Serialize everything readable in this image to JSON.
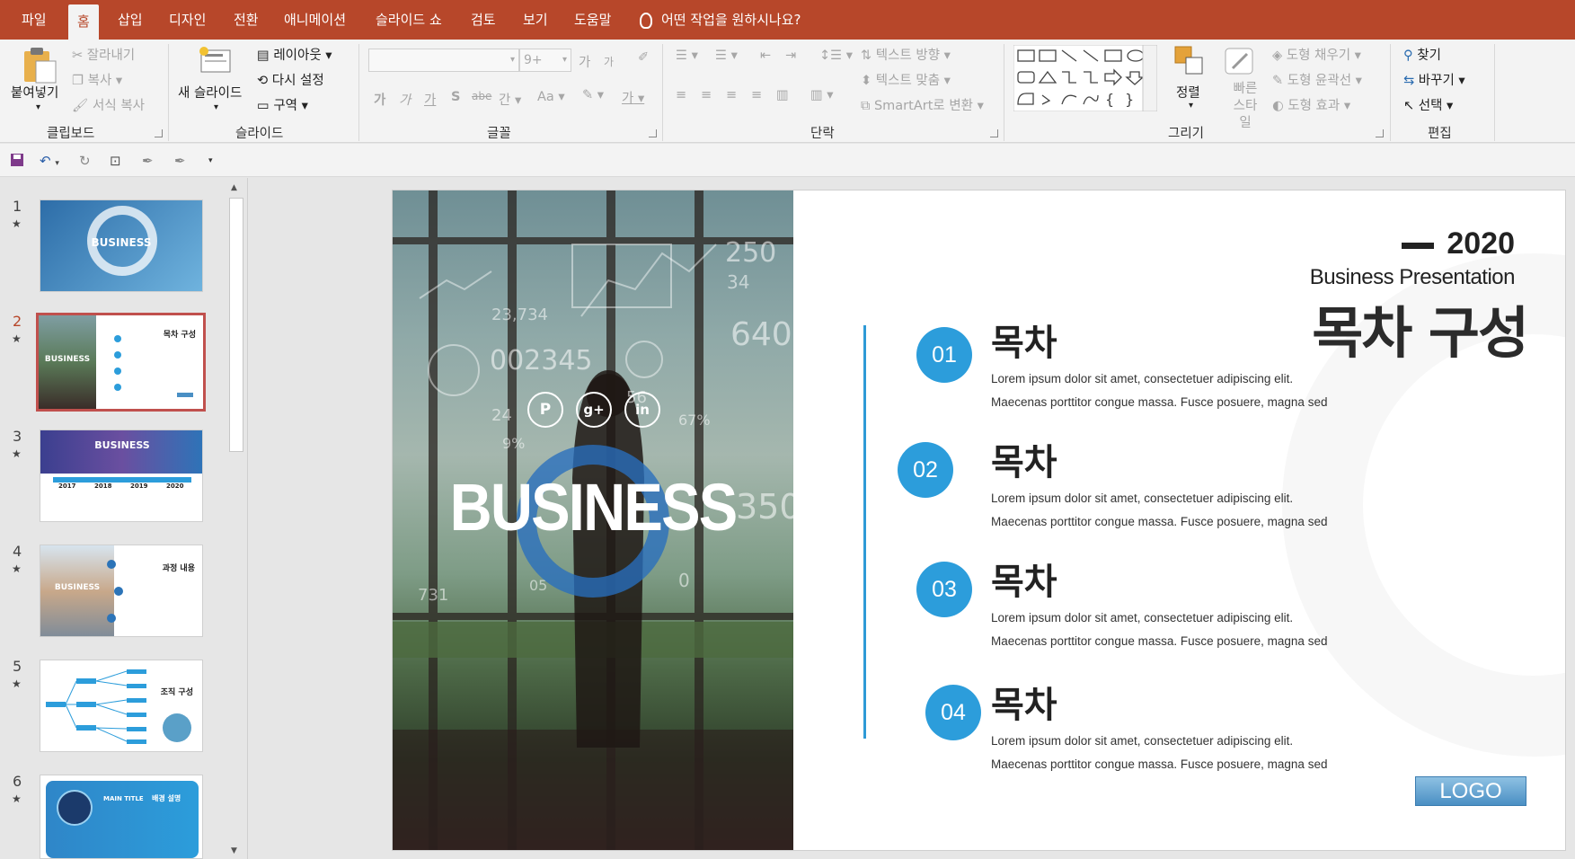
{
  "tabs": [
    "파일",
    "홈",
    "삽입",
    "디자인",
    "전환",
    "애니메이션",
    "슬라이드 쇼",
    "검토",
    "보기",
    "도움말"
  ],
  "active_tab": "홈",
  "tell_me": "어떤 작업을 원하시나요?",
  "ribbon": {
    "clipboard": {
      "paste": "붙여넣기",
      "cut": "잘라내기",
      "copy": "복사",
      "format_painter": "서식 복사",
      "label": "클립보드"
    },
    "slides": {
      "new_slide": "새 슬라이드",
      "layout": "레이아웃",
      "reset": "다시 설정",
      "section": "구역",
      "label": "슬라이드"
    },
    "font": {
      "size": "9+",
      "grow": "가",
      "shrink": "가",
      "bold": "가",
      "italic": "가",
      "underline": "가",
      "shadow": "S",
      "strike": "abe",
      "spacing": "간",
      "case": "Aa",
      "color": "가",
      "label": "글꼴"
    },
    "paragraph": {
      "text_direction": "텍스트 방향",
      "align_text": "텍스트 맞춤",
      "smartart": "SmartArt로 변환",
      "label": "단락"
    },
    "drawing": {
      "arrange": "정렬",
      "quick_styles": "빠른 스타일",
      "fill": "도형 채우기",
      "outline": "도형 윤곽선",
      "effects": "도형 효과",
      "label": "그리기"
    },
    "editing": {
      "find": "찾기",
      "replace": "바꾸기",
      "select": "선택",
      "label": "편집"
    }
  },
  "thumbnails": [
    {
      "num": "1",
      "star": "★",
      "title": "BUSINESS"
    },
    {
      "num": "2",
      "star": "★",
      "title": "BUSINESS",
      "sub": "목차 구성"
    },
    {
      "num": "3",
      "star": "★",
      "title": "BUSINESS",
      "years": [
        "2017",
        "2018",
        "2019",
        "2020"
      ]
    },
    {
      "num": "4",
      "star": "★",
      "title": "BUSINESS",
      "sub": "과정 내용"
    },
    {
      "num": "5",
      "star": "★",
      "sub": "조직 구성"
    },
    {
      "num": "6",
      "star": "★",
      "main": "MAIN TITLE",
      "sub": "배경 설명"
    }
  ],
  "active_slide": "2",
  "slide": {
    "photo_word": "BUSINESS",
    "social": [
      "P",
      "g+",
      "in"
    ],
    "overlay_numbers": [
      "250",
      "34",
      "23,734",
      "002345",
      "640",
      "24",
      "67%",
      "9%",
      "350",
      "56",
      "05",
      "0",
      "731"
    ],
    "year": "2020",
    "subtitle": "Business Presentation",
    "title": "목차 구성",
    "items": [
      {
        "num": "01",
        "title": "목차",
        "line1": "Lorem ipsum dolor sit amet, consectetuer adipiscing elit.",
        "line2": "Maecenas porttitor congue massa. Fusce posuere, magna sed"
      },
      {
        "num": "02",
        "title": "목차",
        "line1": "Lorem ipsum dolor sit amet, consectetuer adipiscing elit.",
        "line2": "Maecenas porttitor congue massa. Fusce posuere, magna sed"
      },
      {
        "num": "03",
        "title": "목차",
        "line1": "Lorem ipsum dolor sit amet, consectetuer adipiscing elit.",
        "line2": "Maecenas porttitor congue massa. Fusce posuere, magna sed"
      },
      {
        "num": "04",
        "title": "목차",
        "line1": "Lorem ipsum dolor sit amet, consectetuer adipiscing elit.",
        "line2": "Maecenas porttitor congue massa. Fusce posuere, magna sed"
      }
    ],
    "logo": "LOGO"
  },
  "colors": {
    "accent": "#b7472a",
    "badge": "#2c9ddb"
  }
}
